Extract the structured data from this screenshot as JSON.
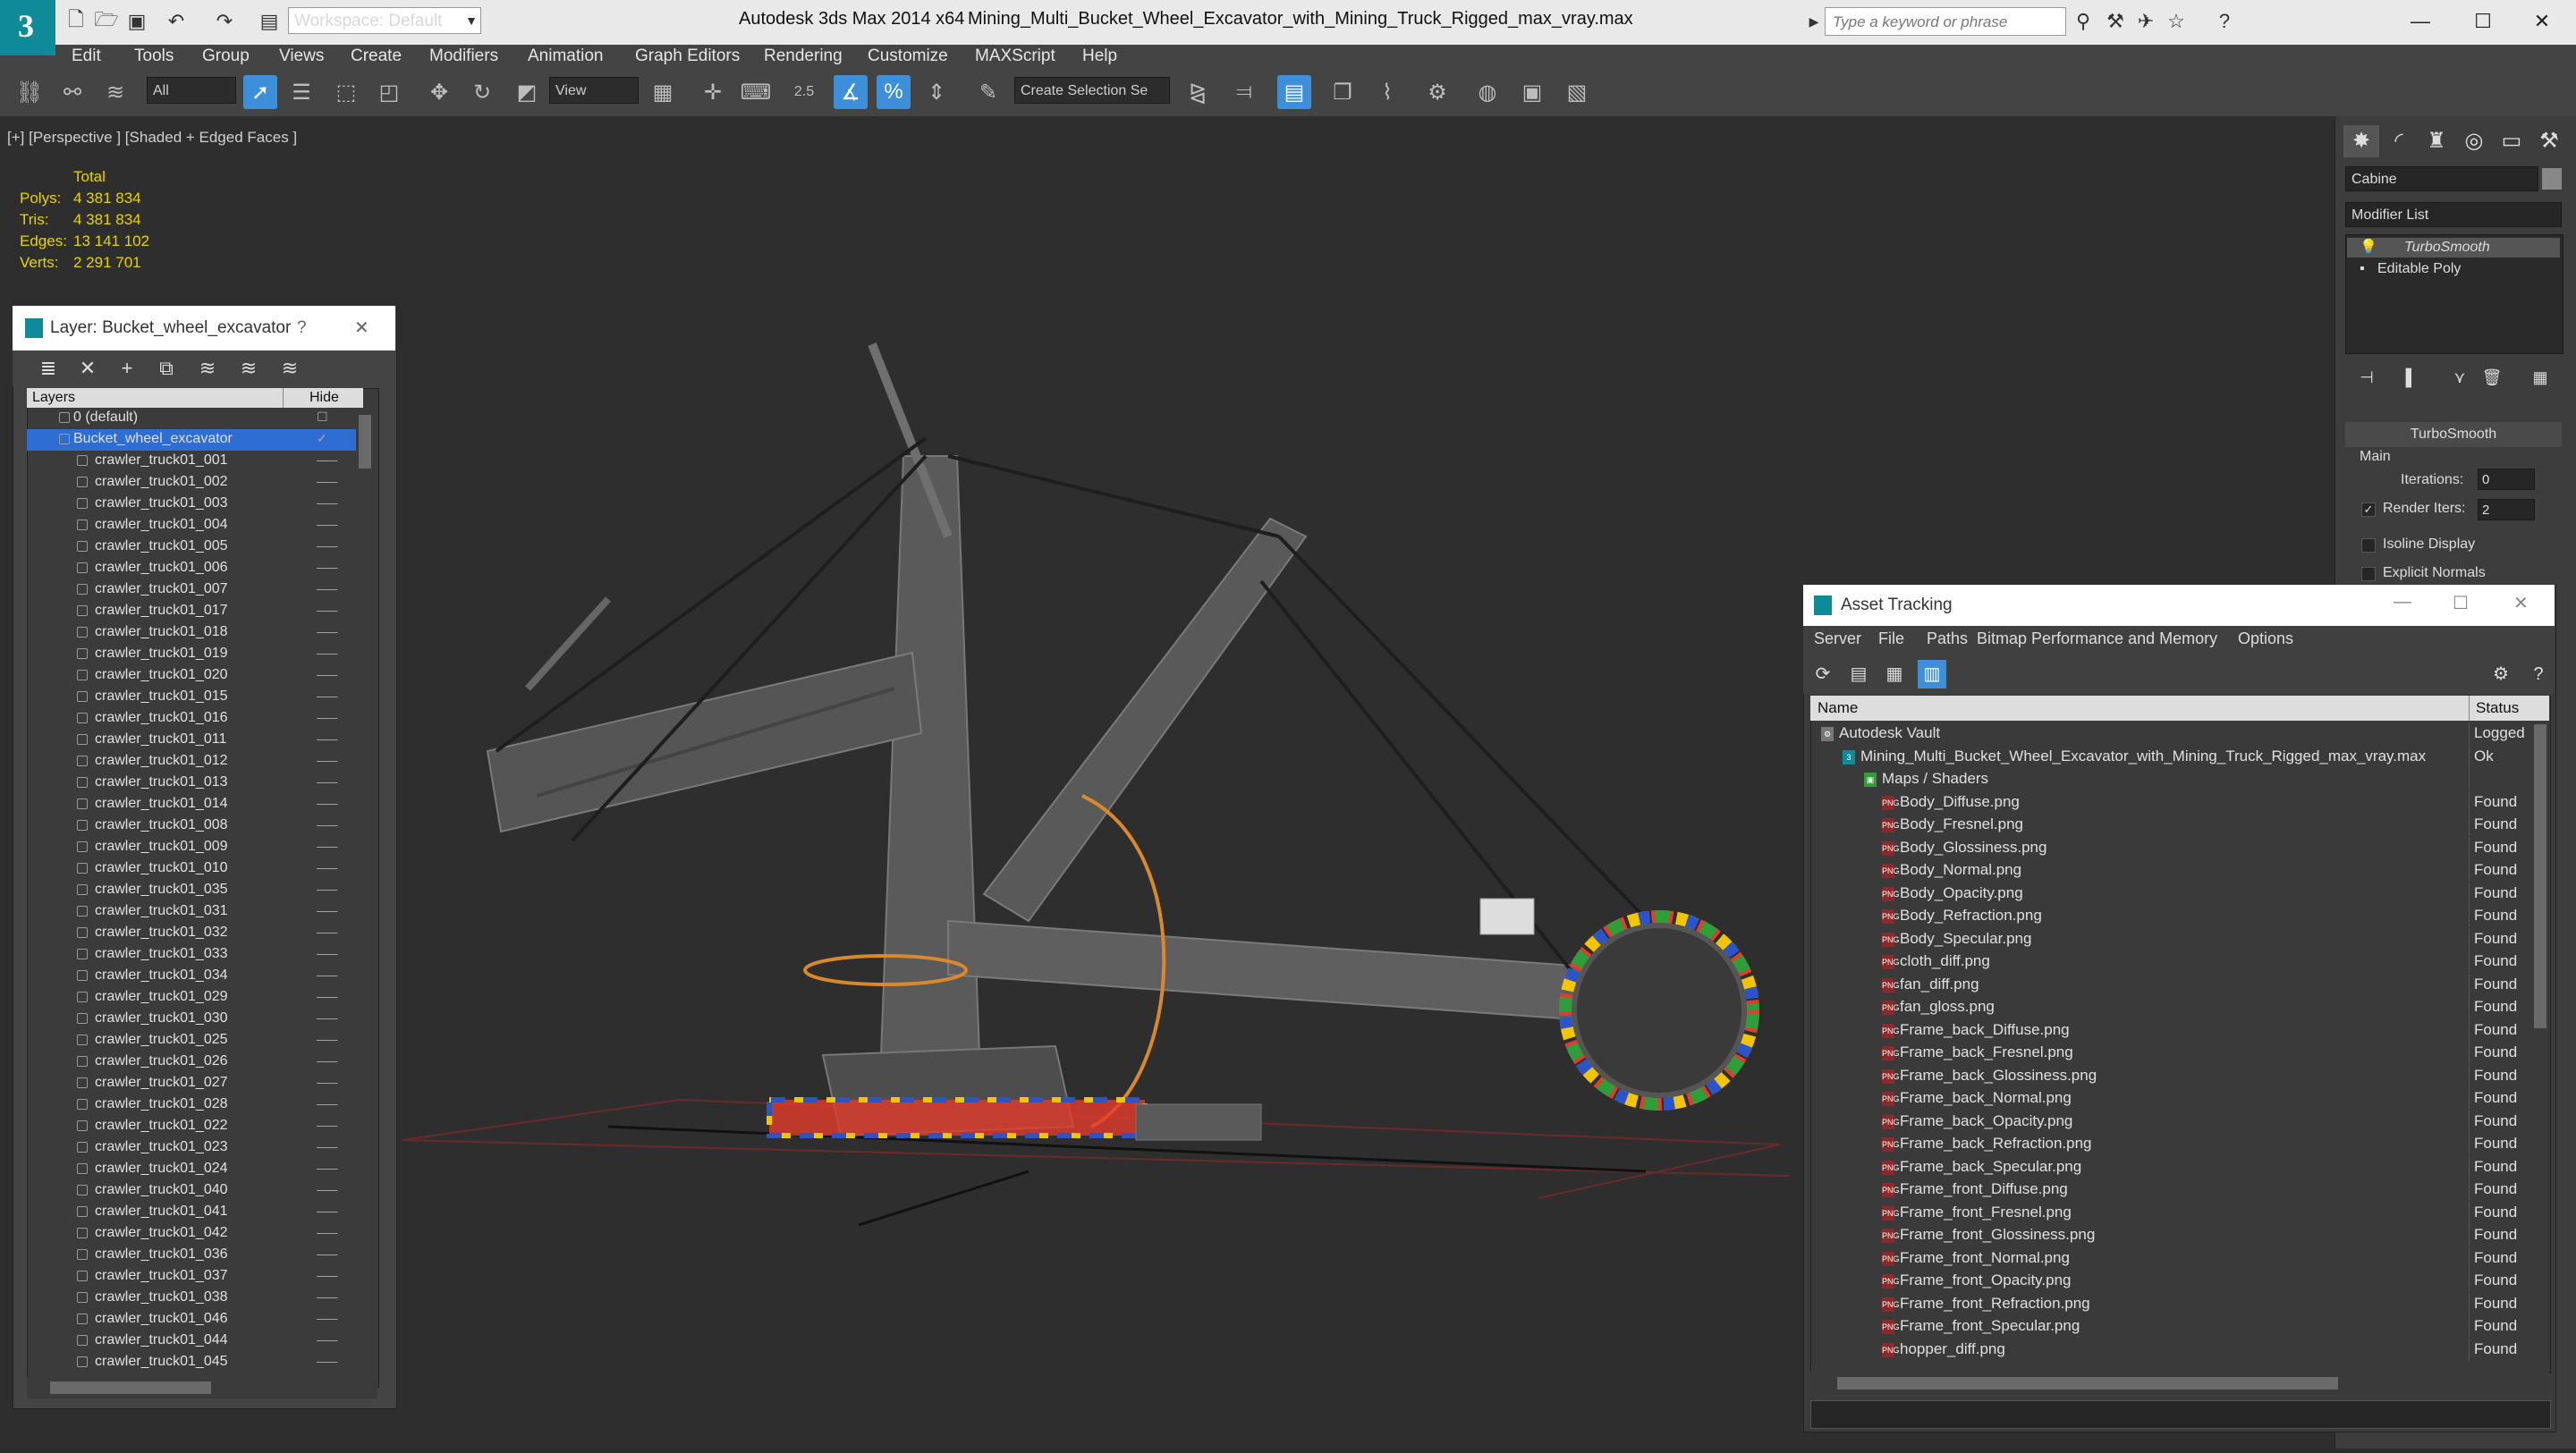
{
  "app": {
    "title": "Autodesk 3ds Max 2014 x64",
    "file_name": "Mining_Multi_Bucket_Wheel_Excavator_with_Mining_Truck_Rigged_max_vray.max",
    "workspace": "Workspace: Default",
    "search_placeholder": "Type a keyword or phrase"
  },
  "menu": [
    "Edit",
    "Tools",
    "Group",
    "Views",
    "Create",
    "Modifiers",
    "Animation",
    "Graph Editors",
    "Rendering",
    "Customize",
    "MAXScript",
    "Help"
  ],
  "toolbar": {
    "selection_filter": "All",
    "ref_coord": "View",
    "named_selection": "Create Selection Se",
    "snap_value": "2.5"
  },
  "viewport": {
    "label": "[+] [Perspective ] [Shaded + Edged Faces ]",
    "stats": {
      "header": "Total",
      "rows": [
        {
          "label": "Polys:",
          "value": "4 381 834"
        },
        {
          "label": "Tris:",
          "value": "4 381 834"
        },
        {
          "label": "Edges:",
          "value": "13 141 102"
        },
        {
          "label": "Verts:",
          "value": "2 291 701"
        }
      ]
    }
  },
  "command_panel": {
    "object_name": "Cabine",
    "modifier_list": "Modifier List",
    "stack": [
      "TurboSmooth",
      "Editable Poly"
    ],
    "rollout_title": "TurboSmooth",
    "group_main": "Main",
    "iterations_label": "Iterations:",
    "iterations_value": "0",
    "render_iters_label": "Render Iters:",
    "render_iters_value": "2",
    "isoline_label": "Isoline Display",
    "explicit_normals_label": "Explicit Normals"
  },
  "layer_panel": {
    "title": "Layer: Bucket_wheel_excavator",
    "help": "?",
    "col_layers": "Layers",
    "col_hide": "Hide",
    "rows": [
      "0 (default)",
      "Bucket_wheel_excavator",
      "crawler_truck01_001",
      "crawler_truck01_002",
      "crawler_truck01_003",
      "crawler_truck01_004",
      "crawler_truck01_005",
      "crawler_truck01_006",
      "crawler_truck01_007",
      "crawler_truck01_017",
      "crawler_truck01_018",
      "crawler_truck01_019",
      "crawler_truck01_020",
      "crawler_truck01_015",
      "crawler_truck01_016",
      "crawler_truck01_011",
      "crawler_truck01_012",
      "crawler_truck01_013",
      "crawler_truck01_014",
      "crawler_truck01_008",
      "crawler_truck01_009",
      "crawler_truck01_010",
      "crawler_truck01_035",
      "crawler_truck01_031",
      "crawler_truck01_032",
      "crawler_truck01_033",
      "crawler_truck01_034",
      "crawler_truck01_029",
      "crawler_truck01_030",
      "crawler_truck01_025",
      "crawler_truck01_026",
      "crawler_truck01_027",
      "crawler_truck01_028",
      "crawler_truck01_022",
      "crawler_truck01_023",
      "crawler_truck01_024",
      "crawler_truck01_040",
      "crawler_truck01_041",
      "crawler_truck01_042",
      "crawler_truck01_036",
      "crawler_truck01_037",
      "crawler_truck01_038",
      "crawler_truck01_046",
      "crawler_truck01_044",
      "crawler_truck01_045"
    ]
  },
  "asset_tracking": {
    "title": "Asset Tracking",
    "menu": [
      "Server",
      "File",
      "Paths",
      "Bitmap Performance and Memory",
      "Options"
    ],
    "col_name": "Name",
    "col_status": "Status",
    "rows": [
      {
        "name": "Autodesk Vault",
        "status": "Logged",
        "level": 0
      },
      {
        "name": "Mining_Multi_Bucket_Wheel_Excavator_with_Mining_Truck_Rigged_max_vray.max",
        "status": "Ok",
        "level": 1
      },
      {
        "name": "Maps / Shaders",
        "status": "",
        "level": 2
      },
      {
        "name": "Body_Diffuse.png",
        "status": "Found",
        "level": 3
      },
      {
        "name": "Body_Fresnel.png",
        "status": "Found",
        "level": 3
      },
      {
        "name": "Body_Glossiness.png",
        "status": "Found",
        "level": 3
      },
      {
        "name": "Body_Normal.png",
        "status": "Found",
        "level": 3
      },
      {
        "name": "Body_Opacity.png",
        "status": "Found",
        "level": 3
      },
      {
        "name": "Body_Refraction.png",
        "status": "Found",
        "level": 3
      },
      {
        "name": "Body_Specular.png",
        "status": "Found",
        "level": 3
      },
      {
        "name": "cloth_diff.png",
        "status": "Found",
        "level": 3
      },
      {
        "name": "fan_diff.png",
        "status": "Found",
        "level": 3
      },
      {
        "name": "fan_gloss.png",
        "status": "Found",
        "level": 3
      },
      {
        "name": "Frame_back_Diffuse.png",
        "status": "Found",
        "level": 3
      },
      {
        "name": "Frame_back_Fresnel.png",
        "status": "Found",
        "level": 3
      },
      {
        "name": "Frame_back_Glossiness.png",
        "status": "Found",
        "level": 3
      },
      {
        "name": "Frame_back_Normal.png",
        "status": "Found",
        "level": 3
      },
      {
        "name": "Frame_back_Opacity.png",
        "status": "Found",
        "level": 3
      },
      {
        "name": "Frame_back_Refraction.png",
        "status": "Found",
        "level": 3
      },
      {
        "name": "Frame_back_Specular.png",
        "status": "Found",
        "level": 3
      },
      {
        "name": "Frame_front_Diffuse.png",
        "status": "Found",
        "level": 3
      },
      {
        "name": "Frame_front_Fresnel.png",
        "status": "Found",
        "level": 3
      },
      {
        "name": "Frame_front_Glossiness.png",
        "status": "Found",
        "level": 3
      },
      {
        "name": "Frame_front_Normal.png",
        "status": "Found",
        "level": 3
      },
      {
        "name": "Frame_front_Opacity.png",
        "status": "Found",
        "level": 3
      },
      {
        "name": "Frame_front_Refraction.png",
        "status": "Found",
        "level": 3
      },
      {
        "name": "Frame_front_Specular.png",
        "status": "Found",
        "level": 3
      },
      {
        "name": "hopper_diff.png",
        "status": "Found",
        "level": 3
      }
    ]
  },
  "colors": {
    "accent": "#3c8fd8",
    "stats_yellow": "#e6d200",
    "selection_blue": "#2e6dd1"
  }
}
